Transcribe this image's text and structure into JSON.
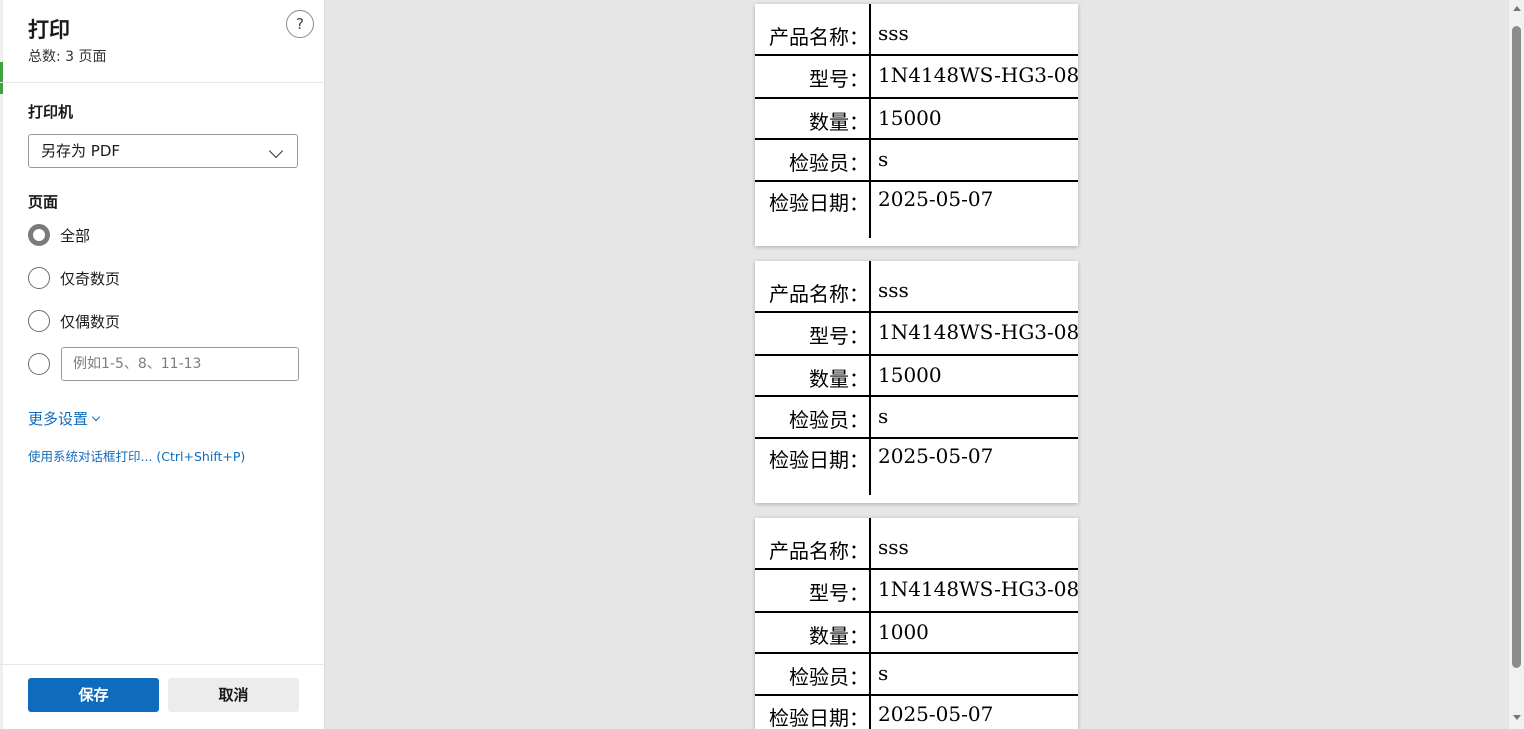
{
  "dialog": {
    "title": "打印",
    "total_pages": "总数: 3 页面",
    "help_label": "?",
    "printer_label": "打印机",
    "printer_value": "另存为 PDF",
    "pages_label": "页面",
    "page_options": [
      {
        "label": "全部",
        "checked": true
      },
      {
        "label": "仅奇数页",
        "checked": false
      },
      {
        "label": "仅偶数页",
        "checked": false
      }
    ],
    "range_placeholder": "例如1-5、8、11-13",
    "more_settings": "更多设置",
    "system_dialog": "使用系统对话框打印... (Ctrl+Shift+P)",
    "save_button": "保存",
    "cancel_button": "取消"
  },
  "preview": {
    "pages": [
      {
        "fields": [
          {
            "label": "产品名称：",
            "value": "sss"
          },
          {
            "label": "型号：",
            "value": "1N4148WS-HG3-08"
          },
          {
            "label": "数量：",
            "value": "15000"
          },
          {
            "label": "检验员：",
            "value": "s"
          },
          {
            "label": "检验日期：",
            "value": "2025-05-07"
          }
        ]
      },
      {
        "fields": [
          {
            "label": "产品名称：",
            "value": "sss"
          },
          {
            "label": "型号：",
            "value": "1N4148WS-HG3-08"
          },
          {
            "label": "数量：",
            "value": "15000"
          },
          {
            "label": "检验员：",
            "value": "s"
          },
          {
            "label": "检验日期：",
            "value": "2025-05-07"
          }
        ]
      },
      {
        "fields": [
          {
            "label": "产品名称：",
            "value": "sss"
          },
          {
            "label": "型号：",
            "value": "1N4148WS-HG3-08"
          },
          {
            "label": "数量：",
            "value": "1000"
          },
          {
            "label": "检验员：",
            "value": "s"
          },
          {
            "label": "检验日期：",
            "value": "2025-05-07"
          }
        ]
      }
    ]
  },
  "colors": {
    "accent": "#0f6cbd",
    "background": "#e6e6e6"
  }
}
